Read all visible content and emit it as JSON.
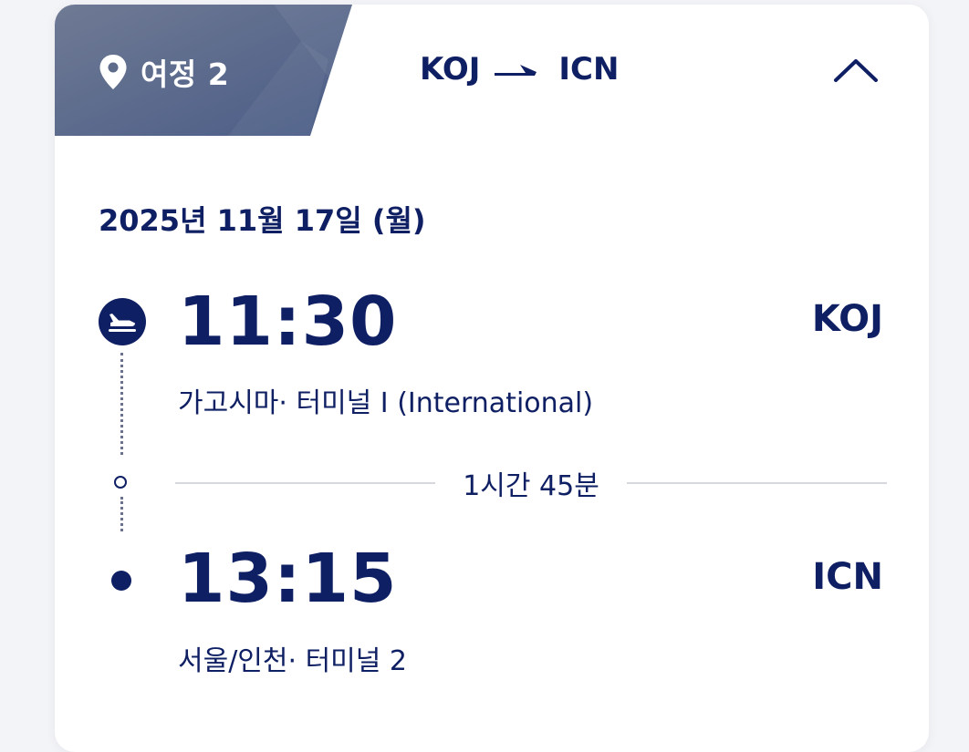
{
  "itinerary": {
    "label": "여정 2",
    "pin_icon": "map-pin-icon",
    "tag_colors": [
      "#6b7590",
      "#4d5f87"
    ]
  },
  "route": {
    "origin": "KOJ",
    "destination": "ICN",
    "arrow_icon": "plane-arrow-icon"
  },
  "collapse": {
    "icon": "chevron-up-icon"
  },
  "flight": {
    "date": "2025년 11월 17일 (월)",
    "departure": {
      "time": "11:30",
      "code": "KOJ",
      "terminal": "가고시마· 터미널  I (International)",
      "icon": "takeoff-icon"
    },
    "duration": "1시간 45분",
    "arrival": {
      "time": "13:15",
      "code": "ICN",
      "terminal": "서울/인천· 터미널  2"
    }
  },
  "colors": {
    "primary": "#0f1f63",
    "divider": "#d6d8de",
    "card": "#ffffff",
    "background": "#f3f4f7"
  }
}
